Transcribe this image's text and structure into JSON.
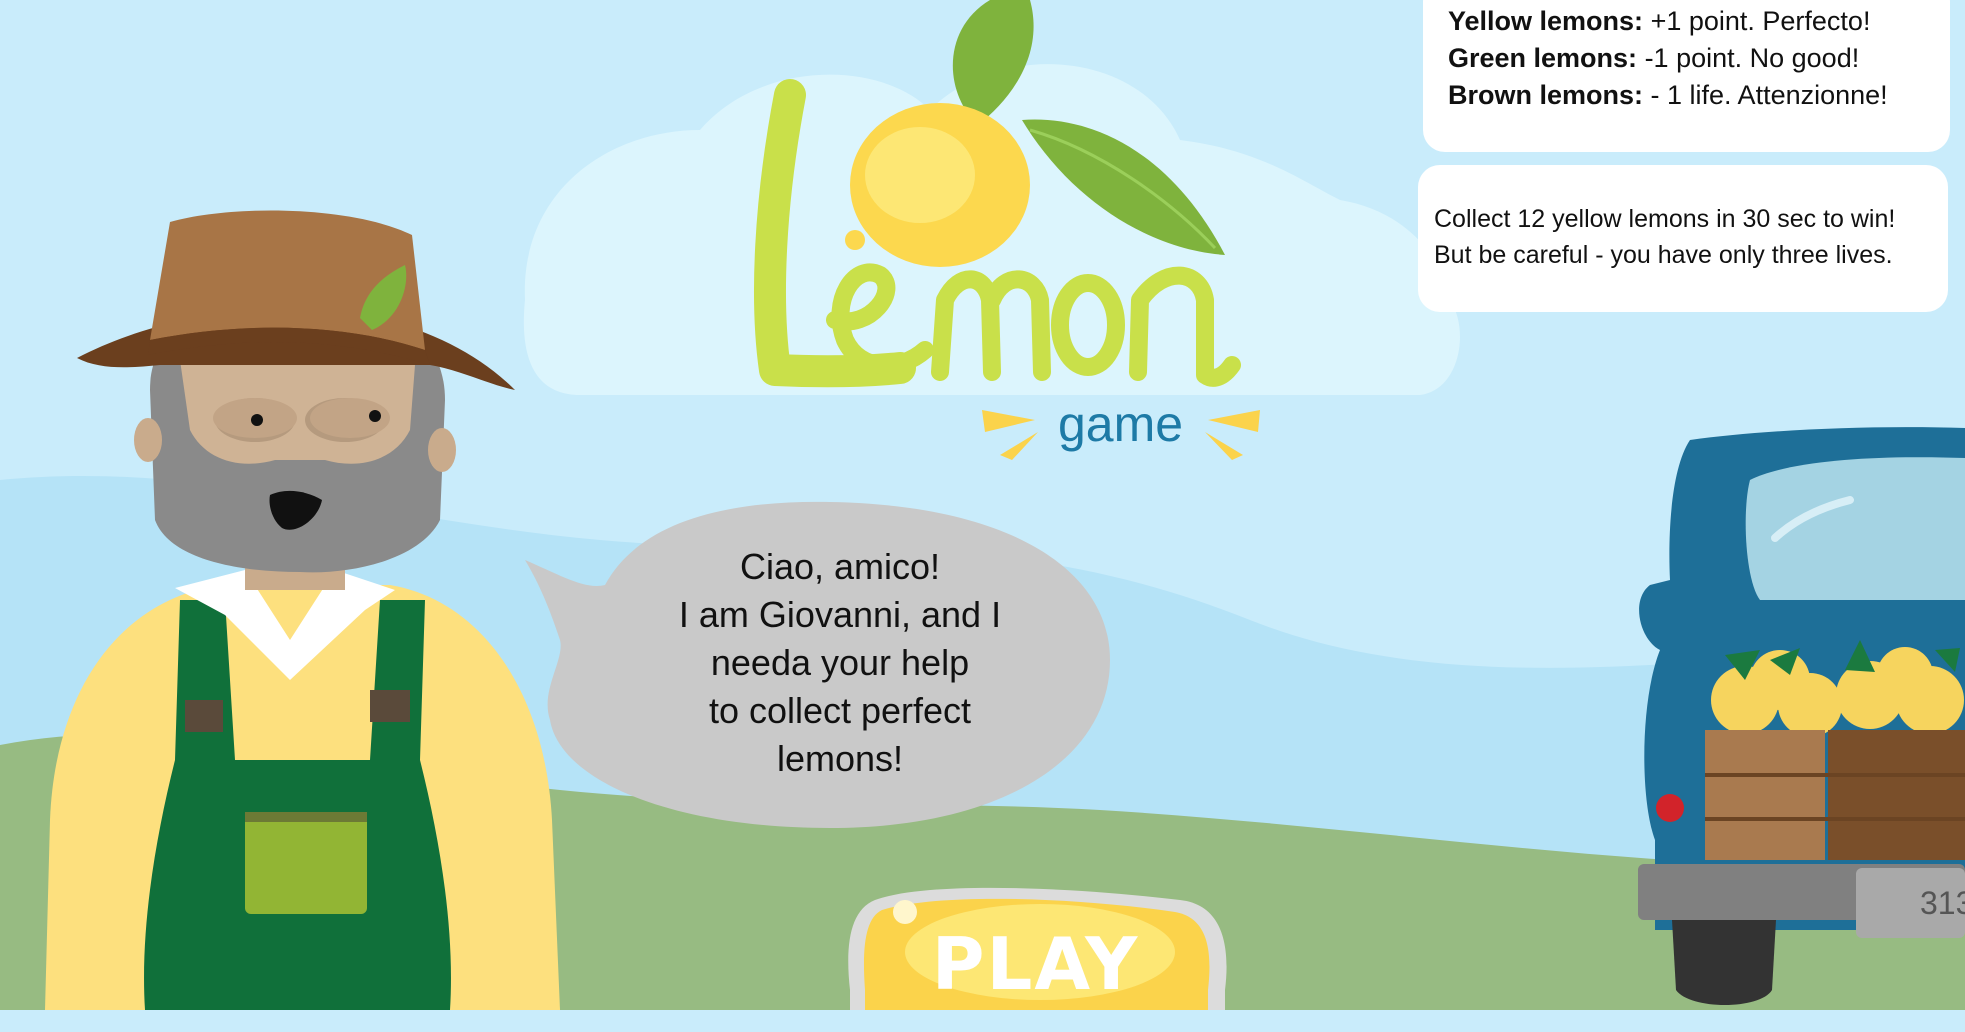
{
  "logo": {
    "title": "Lemon",
    "subtitle": "game"
  },
  "rules": [
    {
      "label": "Yellow lemons:",
      "text": " +1 point. Perfecto!"
    },
    {
      "label": "Green lemons:",
      "text": " -1 point. No good!"
    },
    {
      "label": "Brown lemons:",
      "text": " - 1 life. Attenzionne!"
    }
  ],
  "goal": {
    "line1": "Collect 12 yellow lemons in 30 sec to win!",
    "line2": "But be careful - you have only three lives."
  },
  "speech": {
    "lines": [
      "Ciao, amico!",
      "I am Giovanni, and I",
      "needa your help",
      "to collect perfect",
      "lemons!"
    ]
  },
  "play_button": {
    "label": "PLAY"
  },
  "truck": {
    "plate": "313"
  },
  "colors": {
    "sky": "#c9ecfb",
    "grass": "#97bb82",
    "lemon_text": "#c9e04a",
    "game_text": "#1d7aa6",
    "truck": "#1e6f98",
    "overalls": "#10703a"
  }
}
